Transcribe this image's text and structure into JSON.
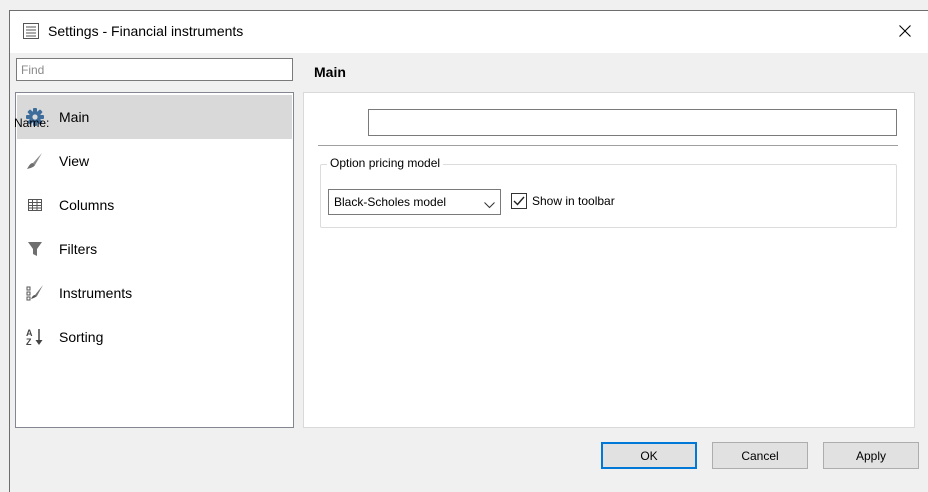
{
  "window": {
    "title": "Settings - Financial instruments"
  },
  "search": {
    "placeholder": "Find"
  },
  "sidebar": {
    "items": [
      {
        "label": "Main",
        "icon": "gear-icon",
        "selected": true
      },
      {
        "label": "View",
        "icon": "brush-icon",
        "selected": false
      },
      {
        "label": "Columns",
        "icon": "table-icon",
        "selected": false
      },
      {
        "label": "Filters",
        "icon": "funnel-icon",
        "selected": false
      },
      {
        "label": "Instruments",
        "icon": "instruments-icon",
        "selected": false
      },
      {
        "label": "Sorting",
        "icon": "sort-az-icon",
        "selected": false
      }
    ]
  },
  "main": {
    "section_title": "Main",
    "name_label": "Name:",
    "name_value": "",
    "group_title": "Option pricing model",
    "pricing_model": "Black-Scholes model",
    "show_in_toolbar_label": "Show in toolbar",
    "show_in_toolbar_checked": true
  },
  "buttons": {
    "ok": "OK",
    "cancel": "Cancel",
    "apply": "Apply"
  },
  "colors": {
    "accent": "#0078d7",
    "selected_bg": "#d9d9d9",
    "gear": "#3e6d9c"
  }
}
